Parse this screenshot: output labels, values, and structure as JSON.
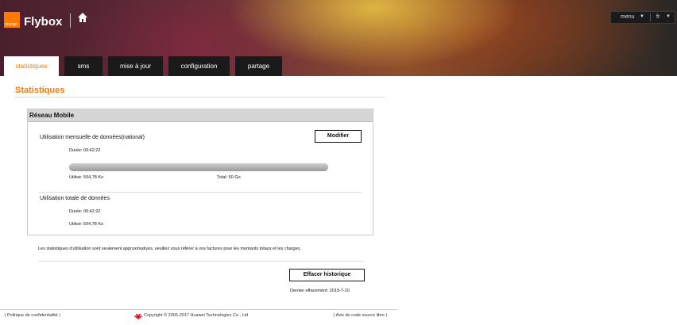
{
  "header": {
    "logo_text": "orange",
    "brand": "Flybox",
    "menu_label": "menu",
    "lang_label": "fr",
    "home_icon": "home-icon",
    "caret_glyph": "▼"
  },
  "tabs": [
    {
      "label": "statistiques",
      "active": true
    },
    {
      "label": "sms",
      "active": false
    },
    {
      "label": "mise à jour",
      "active": false
    },
    {
      "label": "configuration",
      "active": false
    },
    {
      "label": "partage",
      "active": false
    }
  ],
  "page": {
    "title": "Statistiques",
    "panel_title": "Réseau Mobile",
    "monthly": {
      "label": "Utilisation mensuelle de données(national)",
      "modify_button": "Modifier",
      "duration": "Durée: 00:42:22",
      "used": "Utilisé: 504,78 Ko",
      "total": "Total: 50 Go",
      "usage_fraction": 1e-05
    },
    "total_usage": {
      "label": "Utilisation totale de données",
      "duration": "Durée: 00:42:22",
      "used": "Utilisé: 504,78 Ko"
    },
    "note": "Les statistiques d'utilisation sont seulement approximatives, veuillez vous référer à vos factures pour les montants totaux et les charges.",
    "clear_button": "Effacer historique",
    "last_cleared": "Dernier effacement: 2019-7-10"
  },
  "footer": {
    "privacy": "| Politique de confidentialité |",
    "copyright": "Copyright © 2006-2017 Huawei Technologies Co., Ltd",
    "opensource": "| Avis de code source libre |"
  },
  "colors": {
    "accent": "#ff7900",
    "tab_bg": "#1a1a1a"
  }
}
